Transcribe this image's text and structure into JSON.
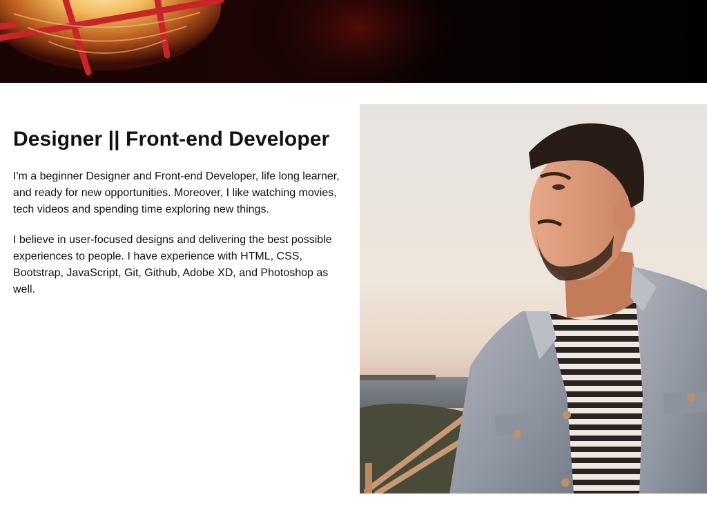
{
  "hero": {
    "image_label": "lamp-banner",
    "colors": {
      "background": "#050203",
      "glow": "#e8a040",
      "cage": "#c8242a"
    }
  },
  "about": {
    "heading": "Designer || Front-end Developer",
    "paragraphs": [
      "I'm a beginner Designer and Front-end Developer, life long learner, and ready for new opportunities. Moreover, I like watching movies, tech videos and spending time exploring new things.",
      "I believe in user-focused designs and delivering the best possible experiences to people. I have experience with HTML, CSS, Bootstrap, JavaScript, Git, Github, Adobe XD, and Photoshop as well."
    ],
    "photo_label": "profile-photo"
  }
}
